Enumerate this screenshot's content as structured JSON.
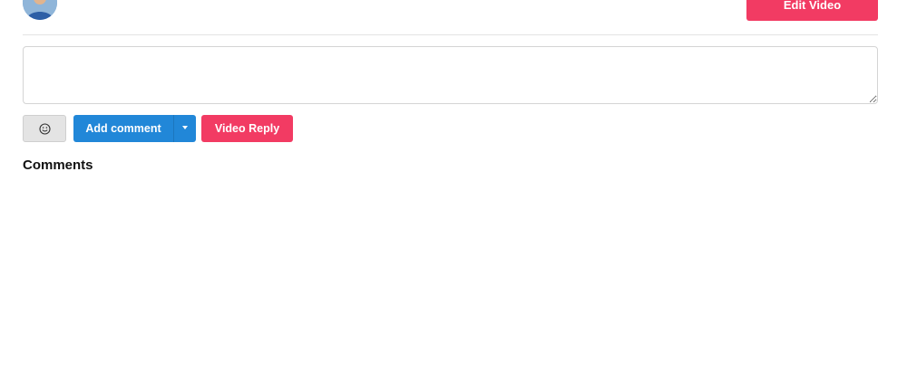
{
  "header": {
    "edit_video_label": "Edit Video",
    "avatar_icon": "user-avatar"
  },
  "comment_box": {
    "value": "",
    "placeholder": ""
  },
  "actions": {
    "emoji_icon": "smiley-face-icon",
    "add_comment_label": "Add comment",
    "dropdown_icon": "caret-down-icon",
    "video_reply_label": "Video Reply"
  },
  "comments": {
    "heading": "Comments"
  },
  "colors": {
    "primary_blue": "#2187d8",
    "accent_red": "#f23b63",
    "neutral_button": "#e4e4e4"
  }
}
